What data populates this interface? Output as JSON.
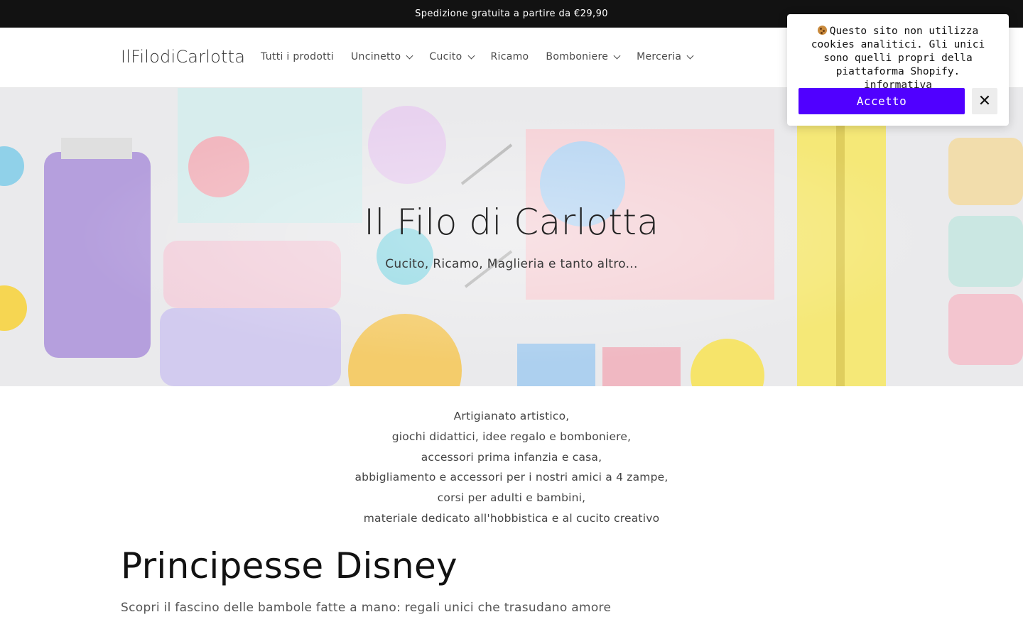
{
  "announcement": {
    "text": "Spedizione gratuita a partire da €29,90"
  },
  "header": {
    "logo": "IlFilodiCarlotta",
    "nav": [
      {
        "label": "Tutti i prodotti",
        "has_dropdown": false
      },
      {
        "label": "Uncinetto",
        "has_dropdown": true
      },
      {
        "label": "Cucito",
        "has_dropdown": true
      },
      {
        "label": "Ricamo",
        "has_dropdown": false
      },
      {
        "label": "Bomboniere",
        "has_dropdown": true
      },
      {
        "label": "Merceria",
        "has_dropdown": true
      }
    ]
  },
  "hero": {
    "title": "Il Filo di Carlotta",
    "subtitle": "Cucito, Ricamo, Maglieria e tanto altro..."
  },
  "intro": {
    "lines": [
      "Artigianato artistico,",
      "giochi didattici, idee regalo e bomboniere,",
      "accessori prima infanzia e casa,",
      "abbigliamento e accessori per i nostri amici a 4 zampe,",
      "corsi per adulti e bambini,",
      "materiale dedicato all'hobbistica e al cucito creativo"
    ]
  },
  "section": {
    "title": "Principesse Disney",
    "subtitle": "Scopri il fascino delle bambole fatte a mano: regali unici che trasudano amore"
  },
  "cookie_banner": {
    "icon": "cookie-icon",
    "text": "Questo sito non utilizza cookies analitici. Gli unici sono quelli propri della piattaforma Shopify.",
    "link_label": "informativa",
    "accept_label": "Accetto",
    "close_icon": "close-icon",
    "accent_color": "#5000ff"
  },
  "colors": {
    "announcement_bg": "#121212",
    "text": "#121212"
  }
}
